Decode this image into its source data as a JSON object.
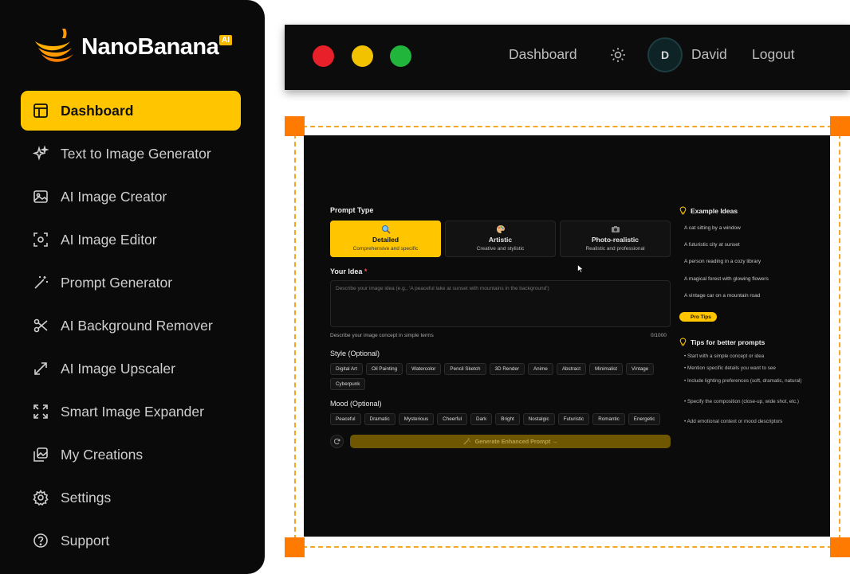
{
  "brand": {
    "name": "NanoBanana",
    "badge": "AI",
    "accent": "#ffc600"
  },
  "sidebar": {
    "items": [
      {
        "label": "Dashboard",
        "icon": "dashboard-icon",
        "active": true
      },
      {
        "label": "Text to Image Generator",
        "icon": "sparkle-icon"
      },
      {
        "label": "AI Image Creator",
        "icon": "image-icon"
      },
      {
        "label": "AI Image Editor",
        "icon": "focus-icon"
      },
      {
        "label": "Prompt Generator",
        "icon": "magic-wand-icon"
      },
      {
        "label": "AI Background Remover",
        "icon": "scissors-icon"
      },
      {
        "label": "AI Image Upscaler",
        "icon": "expand-arrows-icon"
      },
      {
        "label": "Smart Image Expander",
        "icon": "maximize-icon"
      },
      {
        "label": "My Creations",
        "icon": "gallery-icon"
      },
      {
        "label": "Settings",
        "icon": "gear-icon"
      },
      {
        "label": "Support",
        "icon": "help-circle-icon"
      }
    ]
  },
  "topbar": {
    "dashboard": "Dashboard",
    "avatar_initial": "D",
    "user": "David",
    "logout": "Logout"
  },
  "form": {
    "prompt_type_label": "Prompt Type",
    "prompt_types": [
      {
        "title": "Detailed",
        "desc": "Comprehensive and specific",
        "icon": "magnifier-icon",
        "selected": true
      },
      {
        "title": "Artistic",
        "desc": "Creative and stylistic",
        "icon": "palette-icon"
      },
      {
        "title": "Photo-realistic",
        "desc": "Realistic and professional",
        "icon": "camera-icon"
      }
    ],
    "idea_label": "Your Idea",
    "idea_required": "*",
    "idea_placeholder": "Describe your image idea (e.g., 'A peaceful lake at sunset with mountains in the background')",
    "idea_hint": "Describe your image concept in simple terms",
    "char_count": "0/1000",
    "style_label": "Style (Optional)",
    "styles": [
      "Digital Art",
      "Oil Painting",
      "Watercolor",
      "Pencil Sketch",
      "3D Render",
      "Anime",
      "Abstract",
      "Minimalist",
      "Vintage",
      "Cyberpunk"
    ],
    "mood_label": "Mood (Optional)",
    "moods": [
      "Peaceful",
      "Dramatic",
      "Mysterious",
      "Cheerful",
      "Dark",
      "Bright",
      "Nostalgic",
      "Futuristic",
      "Romantic",
      "Energetic"
    ],
    "generate_label": "Generate Enhanced Prompt →"
  },
  "ideas": {
    "title": "Example Ideas",
    "items": [
      "A cat sitting by a window",
      "A futuristic city at sunset",
      "A person reading in a cozy library",
      "A magical forest with glowing flowers",
      "A vintage car on a mountain road"
    ],
    "protips": "Pro Tips"
  },
  "tips": {
    "title": "Tips for better prompts",
    "items": [
      "Start with a simple concept or idea",
      "Mention specific details you want to see",
      "Include lighting preferences (soft, dramatic, natural)",
      "Specify the composition (close-up, wide shot, etc.)",
      "Add emotional context or mood descriptors"
    ]
  }
}
